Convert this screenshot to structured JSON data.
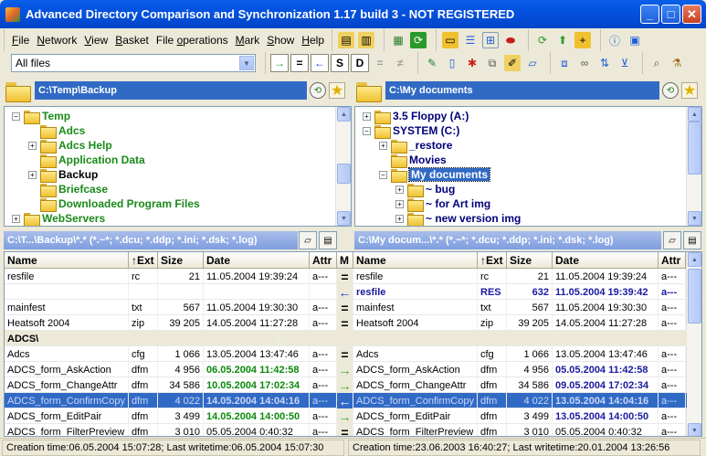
{
  "window": {
    "title": "Advanced Directory Comparison and Synchronization 1.17 build 3 - NOT REGISTERED"
  },
  "menu": [
    {
      "label": "File",
      "u": "F"
    },
    {
      "label": "Network",
      "u": "N"
    },
    {
      "label": "View",
      "u": "V"
    },
    {
      "label": "Basket",
      "u": "B"
    },
    {
      "label": "File operations",
      "u": "o"
    },
    {
      "label": "Mark",
      "u": "M"
    },
    {
      "label": "Show",
      "u": "S"
    },
    {
      "label": "Help",
      "u": "H"
    }
  ],
  "filter": {
    "value": "All files"
  },
  "compare_buttons": [
    "→",
    "=",
    "←",
    "S",
    "D",
    "=",
    "≠"
  ],
  "left": {
    "path": "C:\\Temp\\Backup",
    "mask": "C:\\T...\\Backup\\*.* (*.~*; *.dcu; *.ddp; *.ini; *.dsk; *.log)",
    "tree": [
      {
        "label": "Temp",
        "level": 0,
        "pm": "−",
        "color": "g"
      },
      {
        "label": "Adcs",
        "level": 1,
        "pm": "",
        "color": "g"
      },
      {
        "label": "Adcs Help",
        "level": 1,
        "pm": "+",
        "color": "g"
      },
      {
        "label": "Application Data",
        "level": 1,
        "pm": "",
        "color": "g"
      },
      {
        "label": "Backup",
        "level": 1,
        "pm": "+",
        "color": "k"
      },
      {
        "label": "Briefcase",
        "level": 1,
        "pm": "",
        "color": "g"
      },
      {
        "label": "Downloaded Program Files",
        "level": 1,
        "pm": "",
        "color": "g"
      },
      {
        "label": "WebServers",
        "level": 0,
        "pm": "+",
        "color": "g"
      }
    ],
    "status": "Creation time:06.05.2004 15:07:28; Last writetime:06.05.2004 15:07:30"
  },
  "right": {
    "path": "C:\\My documents",
    "mask": "C:\\My docum...\\*.* (*.~*; *.dcu; *.ddp; *.ini; *.dsk; *.log)",
    "tree": [
      {
        "label": "3.5 Floppy (A:)",
        "level": 0,
        "pm": "+",
        "color": "nv"
      },
      {
        "label": "SYSTEM (C:)",
        "level": 0,
        "pm": "−",
        "color": "nv"
      },
      {
        "label": "_restore",
        "level": 1,
        "pm": "+",
        "color": "nv"
      },
      {
        "label": "Movies",
        "level": 1,
        "pm": "",
        "color": "nv"
      },
      {
        "label": "My documents",
        "level": 1,
        "pm": "−",
        "color": "sel"
      },
      {
        "label": "~ bug",
        "level": 2,
        "pm": "+",
        "color": "nv"
      },
      {
        "label": "~ for Art img",
        "level": 2,
        "pm": "+",
        "color": "nv"
      },
      {
        "label": "~ new version img",
        "level": 2,
        "pm": "+",
        "color": "nv"
      }
    ],
    "status": "Creation time:23.06.2003 16:40:27; Last writetime:20.01.2004 13:26:56"
  },
  "columns": {
    "name": "Name",
    "ext": "↑Ext",
    "size": "Size",
    "date": "Date",
    "attr": "Attr",
    "mid": "M"
  },
  "rows": [
    {
      "type": "file",
      "l": {
        "name": "resfile",
        "ext": "rc",
        "size": "21",
        "date": "11.05.2004 19:39:24",
        "attr": "a---",
        "style": ""
      },
      "m": "=",
      "r": {
        "name": "resfile",
        "ext": "rc",
        "size": "21",
        "date": "11.05.2004 19:39:24",
        "attr": "a---",
        "style": ""
      }
    },
    {
      "type": "file",
      "l": {
        "name": "",
        "ext": "",
        "size": "",
        "date": "",
        "attr": "",
        "style": ""
      },
      "m": "←",
      "r": {
        "name": "resfile",
        "ext": "RES",
        "size": "632",
        "date": "11.05.2004 19:39:42",
        "attr": "a---",
        "style": "b"
      }
    },
    {
      "type": "file",
      "l": {
        "name": "mainfest",
        "ext": "txt",
        "size": "567",
        "date": "11.05.2004 19:30:30",
        "attr": "a---",
        "style": ""
      },
      "m": "=",
      "r": {
        "name": "mainfest",
        "ext": "txt",
        "size": "567",
        "date": "11.05.2004 19:30:30",
        "attr": "a---",
        "style": ""
      }
    },
    {
      "type": "file",
      "l": {
        "name": "Heatsoft 2004",
        "ext": "zip",
        "size": "39 205",
        "date": "14.05.2004 11:27:28",
        "attr": "a---",
        "style": ""
      },
      "m": "=",
      "r": {
        "name": "Heatsoft 2004",
        "ext": "zip",
        "size": "39 205",
        "date": "14.05.2004 11:27:28",
        "attr": "a---",
        "style": ""
      }
    },
    {
      "type": "group",
      "label": "ADCS\\"
    },
    {
      "type": "file",
      "l": {
        "name": "Adcs",
        "ext": "cfg",
        "size": "1 066",
        "date": "13.05.2004 13:47:46",
        "attr": "a---",
        "style": ""
      },
      "m": "=",
      "r": {
        "name": "Adcs",
        "ext": "cfg",
        "size": "1 066",
        "date": "13.05.2004 13:47:46",
        "attr": "a---",
        "style": ""
      }
    },
    {
      "type": "file",
      "l": {
        "name": "ADCS_form_AskAction",
        "ext": "dfm",
        "size": "4 956",
        "date": "06.05.2004 11:42:58",
        "attr": "a---",
        "style": "gdate"
      },
      "m": "→",
      "r": {
        "name": "ADCS_form_AskAction",
        "ext": "dfm",
        "size": "4 956",
        "date": "05.05.2004 11:42:58",
        "attr": "a---",
        "style": "bdate"
      }
    },
    {
      "type": "file",
      "l": {
        "name": "ADCS_form_ChangeAttr",
        "ext": "dfm",
        "size": "34 586",
        "date": "10.05.2004 17:02:34",
        "attr": "a---",
        "style": "gdate"
      },
      "m": "→",
      "r": {
        "name": "ADCS_form_ChangeAttr",
        "ext": "dfm",
        "size": "34 586",
        "date": "09.05.2004 17:02:34",
        "attr": "a---",
        "style": "bdate"
      }
    },
    {
      "type": "file",
      "sel": true,
      "l": {
        "name": "ADCS_form_ConfirmCopy",
        "ext": "dfm",
        "size": "4 022",
        "date": "14.05.2004 14:04:16",
        "attr": "a---",
        "style": "seldate"
      },
      "m": "←",
      "r": {
        "name": "ADCS_form_ConfirmCopy",
        "ext": "dfm",
        "size": "4 022",
        "date": "13.05.2004 14:04:16",
        "attr": "a---",
        "style": "seldate"
      }
    },
    {
      "type": "file",
      "l": {
        "name": "ADCS_form_EditPair",
        "ext": "dfm",
        "size": "3 499",
        "date": "14.05.2004 14:00:50",
        "attr": "a---",
        "style": "gdate"
      },
      "m": "→",
      "r": {
        "name": "ADCS_form_EditPair",
        "ext": "dfm",
        "size": "3 499",
        "date": "13.05.2004 14:00:50",
        "attr": "a---",
        "style": "bdate"
      }
    },
    {
      "type": "file",
      "l": {
        "name": "ADCS_form_FilterPreview",
        "ext": "dfm",
        "size": "3 010",
        "date": "05.05.2004 0:40:32",
        "attr": "a---",
        "style": ""
      },
      "m": "=",
      "r": {
        "name": "ADCS_form_FilterPreview",
        "ext": "dfm",
        "size": "3 010",
        "date": "05.05.2004 0:40:32",
        "attr": "a---",
        "style": ""
      }
    }
  ],
  "icons": {
    "folder": "folder-icon",
    "refresh": "refresh-icon",
    "favorite": "star-icon"
  }
}
